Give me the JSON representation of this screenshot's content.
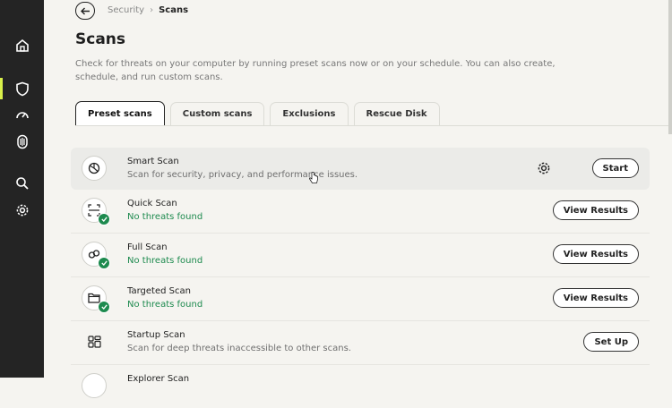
{
  "breadcrumb": {
    "parent": "Security",
    "separator": "›",
    "current": "Scans"
  },
  "page": {
    "title": "Scans",
    "description": "Check for threats on your computer by running preset scans now or on your schedule. You can also create, schedule, and run custom scans."
  },
  "tabs": [
    {
      "label": "Preset scans",
      "active": true
    },
    {
      "label": "Custom scans",
      "active": false
    },
    {
      "label": "Exclusions",
      "active": false
    },
    {
      "label": "Rescue Disk",
      "active": false
    }
  ],
  "scans": [
    {
      "name": "Smart Scan",
      "subtitle": "Scan for security, privacy, and performance issues.",
      "action": "Start",
      "status": "none",
      "icon": "smart-scan-icon"
    },
    {
      "name": "Quick Scan",
      "subtitle": "No threats found",
      "action": "View Results",
      "status": "ok",
      "icon": "quick-scan-icon"
    },
    {
      "name": "Full Scan",
      "subtitle": "No threats found",
      "action": "View Results",
      "status": "ok",
      "icon": "full-scan-icon"
    },
    {
      "name": "Targeted Scan",
      "subtitle": "No threats found",
      "action": "View Results",
      "status": "ok",
      "icon": "folder-icon"
    },
    {
      "name": "Startup Scan",
      "subtitle": "Scan for deep threats inaccessible to other scans.",
      "action": "Set Up",
      "status": "none",
      "icon": "startup-scan-icon"
    },
    {
      "name": "Explorer Scan",
      "subtitle": "",
      "action": "",
      "status": "none",
      "icon": "explorer-scan-icon"
    }
  ],
  "sidebar": {
    "items": [
      {
        "icon": "home-icon",
        "active": false
      },
      {
        "icon": "shield-icon",
        "active": true
      },
      {
        "icon": "gauge-icon",
        "active": false
      },
      {
        "icon": "fingerprint-icon",
        "active": false
      },
      {
        "icon": "search-icon",
        "active": false
      },
      {
        "icon": "gear-icon",
        "active": false
      }
    ]
  },
  "colors": {
    "sidebar": "#242424",
    "accent": "#d9f04a",
    "ok": "#1d8a4e",
    "background": "#f5f4f0"
  }
}
